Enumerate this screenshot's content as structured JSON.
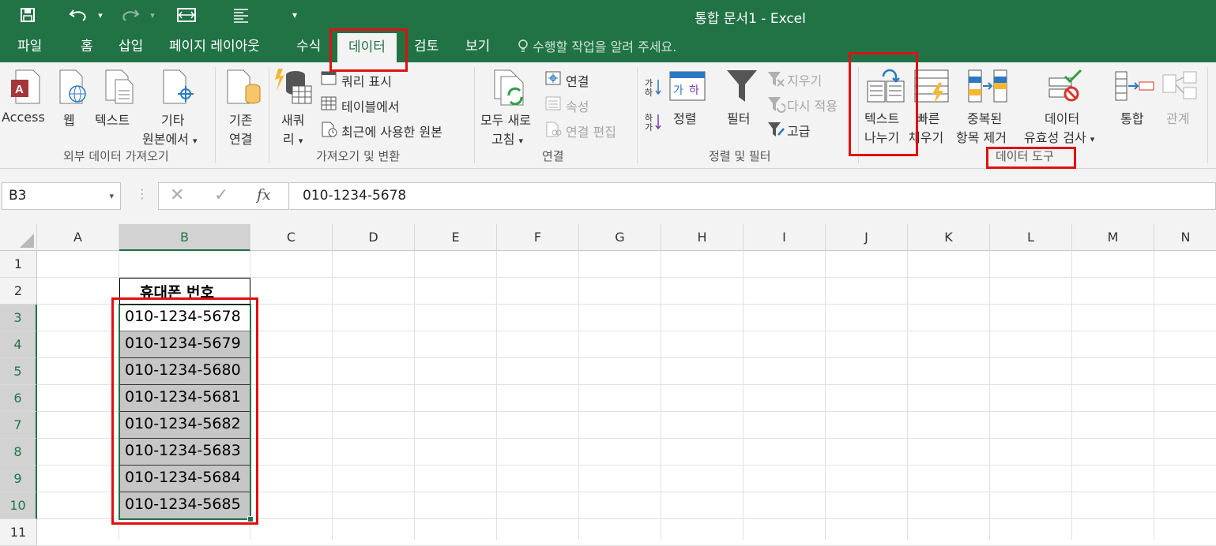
{
  "window": {
    "title": "통합 문서1 - Excel"
  },
  "tabs": [
    {
      "label": "파일"
    },
    {
      "label": "홈"
    },
    {
      "label": "삽입"
    },
    {
      "label": "페이지 레이아웃"
    },
    {
      "label": "수식"
    },
    {
      "label": "데이터"
    },
    {
      "label": "검토"
    },
    {
      "label": "보기"
    }
  ],
  "tell_me": "수행할 작업을 알려 주세요.",
  "ribbon": {
    "external": {
      "access": "Access",
      "web": "웹",
      "text": "텍스트",
      "other1": "기타",
      "other2": "원본에서",
      "existing1": "기존",
      "existing2": "연결",
      "group": "외부 데이터 가져오기"
    },
    "transform": {
      "newquery1": "새쿼",
      "newquery2": "리",
      "show_query": "쿼리 표시",
      "from_table": "테이블에서",
      "recent": "최근에 사용한 원본",
      "group": "가져오기 및 변환"
    },
    "connections": {
      "refresh1": "모두 새로",
      "refresh2": "고침",
      "connections": "연결",
      "properties": "속성",
      "edit_links": "연결 편집",
      "group": "연결"
    },
    "sortfilter": {
      "sort": "정렬",
      "filter": "필터",
      "clear": "지우기",
      "reapply": "다시 적용",
      "advanced": "고급",
      "group": "정렬 및 필터"
    },
    "datatools": {
      "text_to_cols1": "텍스트",
      "text_to_cols2": "나누기",
      "flash1": "빠른",
      "flash2": "채우기",
      "dup1": "중복된",
      "dup2": "항목 제거",
      "valid1": "데이터",
      "valid2": "유효성 검사",
      "consolidate": "통합",
      "relations": "관계",
      "group": "데이터 도구"
    }
  },
  "formula_bar": {
    "name_box": "B3",
    "fx": "fx",
    "value": "010-1234-5678"
  },
  "columns": [
    "A",
    "B",
    "C",
    "D",
    "E",
    "F",
    "G",
    "H",
    "I",
    "J",
    "K",
    "L",
    "M",
    "N"
  ],
  "rows": [
    "1",
    "2",
    "3",
    "4",
    "5",
    "6",
    "7",
    "8",
    "9",
    "10",
    "11"
  ],
  "cells": {
    "B2": "휴대폰 번호",
    "B3": "010-1234-5678",
    "B4": "010-1234-5679",
    "B5": "010-1234-5680",
    "B6": "010-1234-5681",
    "B7": "010-1234-5682",
    "B8": "010-1234-5683",
    "B9": "010-1234-5684",
    "B10": "010-1234-5685"
  },
  "colors": {
    "excel_green": "#217346",
    "highlight_red": "#e01010",
    "selection_gray": "#c6c6c6"
  }
}
